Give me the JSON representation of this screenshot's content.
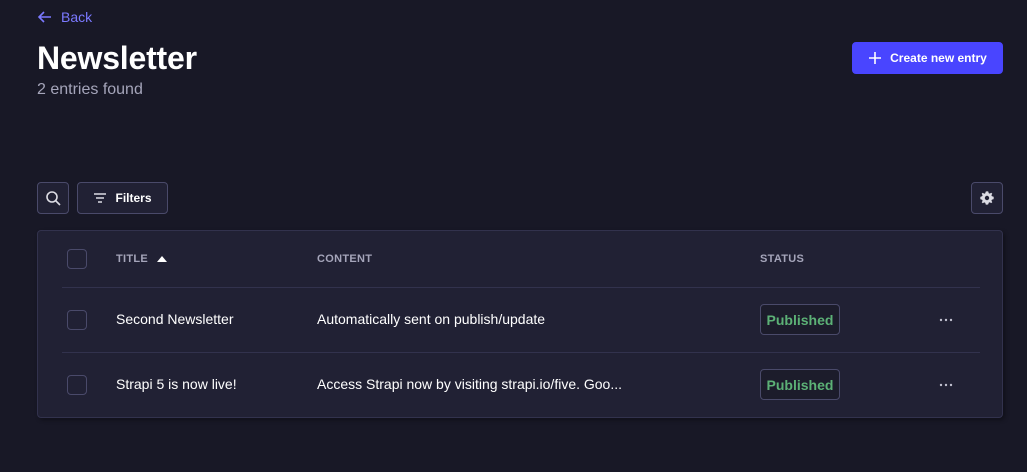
{
  "nav": {
    "back_label": "Back"
  },
  "header": {
    "title": "Newsletter",
    "subtitle": "2 entries found",
    "create_label": "Create new entry"
  },
  "toolbar": {
    "filters_label": "Filters"
  },
  "table": {
    "columns": {
      "title": "TITLE",
      "content": "CONTENT",
      "status": "STATUS"
    },
    "rows": [
      {
        "title": "Second Newsletter",
        "content": "Automatically sent on publish/update",
        "status": "Published"
      },
      {
        "title": "Strapi 5 is now live!",
        "content": "Access Strapi now by visiting strapi.io/five. Goo...",
        "status": "Published"
      }
    ]
  },
  "colors": {
    "background": "#181826",
    "surface": "#212134",
    "primary": "#4945ff",
    "link": "#7b79ff",
    "published": "#5cb176",
    "muted_text": "#a5a5ba"
  },
  "icons": {
    "back": "arrow-left-icon",
    "create": "plus-icon",
    "search": "search-icon",
    "filters": "filter-icon",
    "settings": "gear-icon",
    "sort": "sort-ascending-icon",
    "row_actions": "more-dots-icon"
  }
}
